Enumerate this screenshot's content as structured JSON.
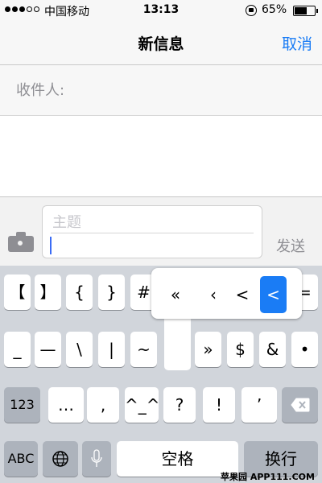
{
  "status_bar": {
    "carrier": "中国移动",
    "time": "13:13",
    "battery_percent": "65%"
  },
  "nav": {
    "title": "新信息",
    "cancel_label": "取消"
  },
  "recipient": {
    "label": "收件人:"
  },
  "compose": {
    "subject_placeholder": "主题",
    "send_label": "发送"
  },
  "keyboard": {
    "row1": [
      "【",
      "】",
      "{",
      "}",
      "#",
      "="
    ],
    "row2": [
      "_",
      "—",
      "\\",
      "|",
      "~",
      "»",
      "$",
      "&",
      "•"
    ],
    "row3": [
      "123",
      "…",
      ",",
      "^_^",
      "?",
      "!",
      "’"
    ],
    "row4": [
      "ABC",
      "空格",
      "换行"
    ]
  },
  "popup": {
    "options": [
      "«",
      "‹",
      "<",
      "<"
    ],
    "selected_index": 3
  },
  "watermark": "苹果园 APP111.COM",
  "colors": {
    "accent": "#1a7cf5",
    "keyboard_bg": "#d1d5db",
    "dark_key": "#adb3bc"
  }
}
